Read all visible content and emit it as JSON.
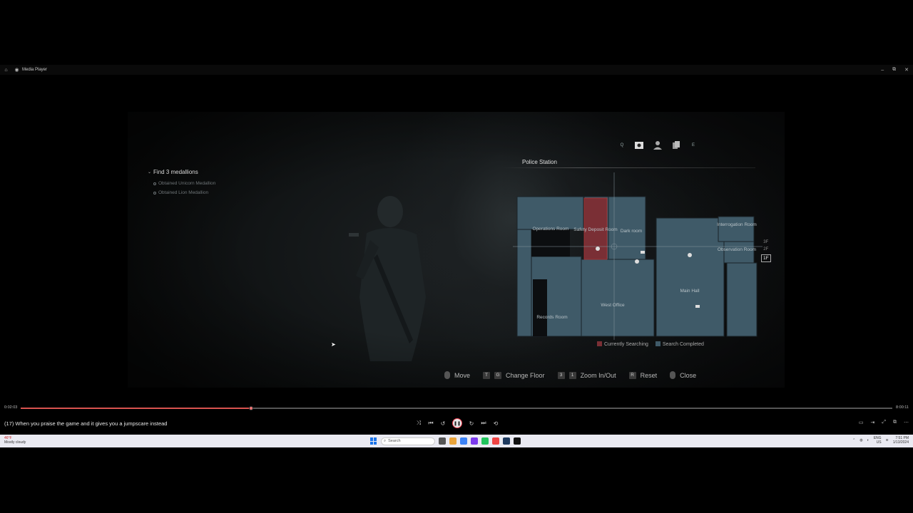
{
  "window": {
    "title": "Media Player"
  },
  "game": {
    "objectives": {
      "title": "Find 3 medallions",
      "items": [
        "Obtained Unicorn Medallion",
        "Obtained Lion Medallion"
      ]
    },
    "map": {
      "tab_left_key": "Q",
      "tab_right_key": "E",
      "title": "Police Station",
      "rooms": {
        "operations": "Operations Room",
        "safety_deposit": "Safety Deposit Room",
        "dark_room": "Dark room",
        "interrogation": "Interrogation Room",
        "observation": "Observation Room",
        "main_hall": "Main Hall",
        "west_office": "West Office",
        "records": "Records Room"
      },
      "floors": [
        "3F",
        "2F",
        "1F"
      ],
      "active_floor": "1F",
      "legend": {
        "searching": "Currently Searching",
        "completed": "Search Completed"
      },
      "colors": {
        "searching": "#7a2f35",
        "completed": "#3f5a68",
        "room": "#3f5a68"
      }
    },
    "controls": {
      "move": "Move",
      "floor_key1": "T",
      "floor_key2": "G",
      "change_floor": "Change Floor",
      "zoom_key": "3",
      "zoom_key2": "1",
      "zoom": "Zoom In/Out",
      "reset_key": "R",
      "reset": "Reset",
      "close": "Close"
    }
  },
  "player": {
    "time_current": "0:02:03",
    "time_total": "8:00:11",
    "progress": 0.264,
    "video_title": "(17) When you praise the game and it gives you a jumpscare instead",
    "accent_color": "#d9534f"
  },
  "taskbar": {
    "weather_temp": "46°F",
    "weather_desc": "Mostly cloudy",
    "search_placeholder": "Search",
    "lang1": "ENG",
    "lang2": "US",
    "time": "7:51 PM",
    "date": "1/13/2024"
  }
}
